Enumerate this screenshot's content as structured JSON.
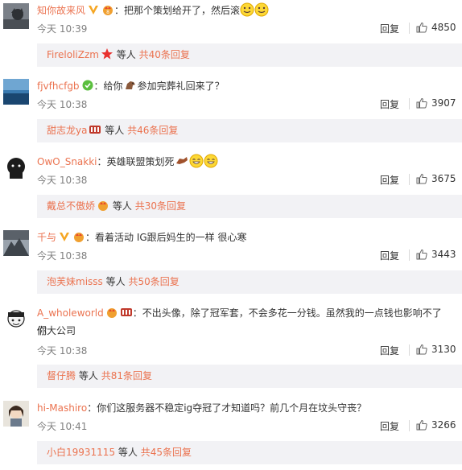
{
  "comments": [
    {
      "username": "知你故来风",
      "text": "：把那个策划给开了，然后滚",
      "time": "今天 10:39",
      "reply_label": "回复",
      "likes": "4850",
      "sub_name": "FireloliZzm",
      "sub_suffix": "等人",
      "sub_count": "共40条回复"
    },
    {
      "username": "fjvfhcfgb",
      "text_before": "：给你",
      "text_after": "参加完葬礼回来了？",
      "time": "今天 10:38",
      "reply_label": "回复",
      "likes": "3907",
      "sub_name": "甜志龙ya",
      "sub_suffix": "等人",
      "sub_count": "共46条回复"
    },
    {
      "username": "OwO_Snakki",
      "text": "：英雄联盟策划死",
      "time": "今天 10:38",
      "reply_label": "回复",
      "likes": "3675",
      "sub_name": "戴总不傲娇",
      "sub_suffix": "等人",
      "sub_count": "共30条回复"
    },
    {
      "username": "千与",
      "text": "：看着活动 IG跟后妈生的一样 很心寒",
      "time": "今天 10:38",
      "reply_label": "回复",
      "likes": "3443",
      "sub_name": "泡芙妹misss",
      "sub_suffix": "等人",
      "sub_count": "共50条回复"
    },
    {
      "username": "A_wholeworld",
      "text": "：不出头像，除了冠军套，不会多花一分钱。虽然我的一点钱也影响不了你",
      "text_line2": "们大公司",
      "time": "今天 10:38",
      "reply_label": "回复",
      "likes": "3130",
      "sub_name": "督仔腾",
      "sub_suffix": "等人",
      "sub_count": "共81条回复"
    },
    {
      "username": "hi-Mashiro",
      "text": "：你们这服务器不稳定ig夺冠了才知道吗？前几个月在坟头守丧？",
      "time": "今天 10:41",
      "reply_label": "回复",
      "likes": "3266",
      "sub_name": "小白19931115",
      "sub_suffix": "等人",
      "sub_count": "共45条回复"
    }
  ],
  "icons": {
    "like": "thumbs-up-icon",
    "vip_badge": "vip-v-icon",
    "member_badge": "member-crown-icon",
    "emoji_smile": "smile-emoji-icon",
    "emoji_laugh": "laugh-emoji-icon",
    "star": "red-star-icon",
    "horse": "horse-emoji-icon",
    "dog": "dog-emoji-icon"
  },
  "colors": {
    "accent": "#eb7350",
    "subbox_bg": "#f2f2f5",
    "text": "#333333",
    "meta": "#808080"
  }
}
